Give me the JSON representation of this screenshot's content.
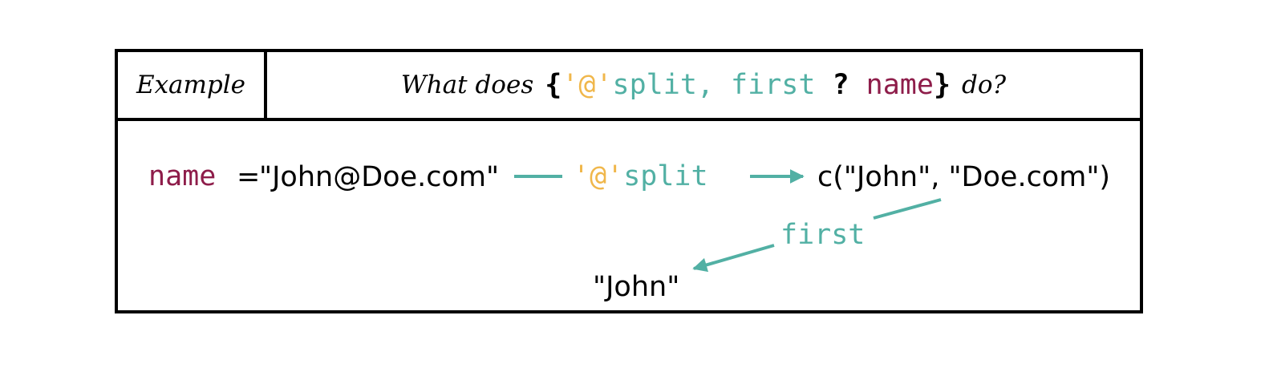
{
  "header": {
    "example_label": "Example",
    "question_prefix": "What does",
    "question_suffix": "do?",
    "code": {
      "open_brace": "{",
      "split_quote": "'@'",
      "split_fn": "split,",
      "first_fn": "first",
      "question_mark": "?",
      "name_var": "name",
      "close_brace": "}"
    }
  },
  "diagram": {
    "input_var": "name",
    "equals": "=",
    "input_value": "\"John@Doe.com\"",
    "step1_quote": "'@'",
    "step1_fn": "split",
    "step1_result": "c(\"John\", \"Doe.com\")",
    "step2_fn": "first",
    "step2_result": "\"John\""
  },
  "colors": {
    "teal": "#52b0a4",
    "gold": "#f0b74b",
    "maroon": "#8e1d4a",
    "black": "#000000"
  }
}
